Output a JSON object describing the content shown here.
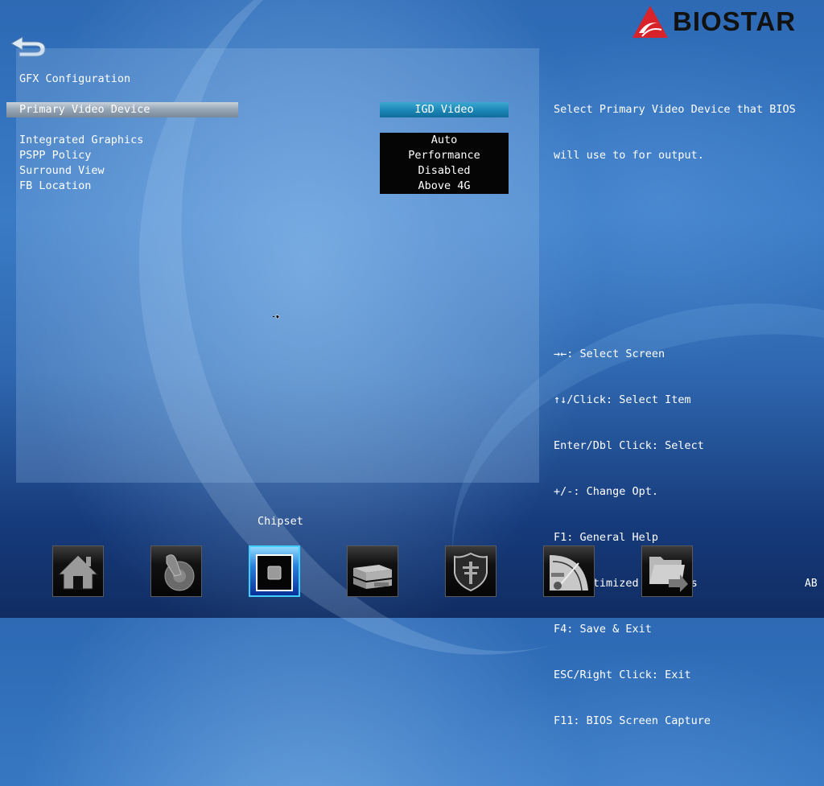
{
  "brand": {
    "name": "BIOSTAR"
  },
  "page": {
    "section_title": "GFX Configuration",
    "settings": [
      {
        "label": "Primary Video Device",
        "value": "IGD Video",
        "selected": true
      },
      {
        "label": "Integrated Graphics",
        "value": "Auto"
      },
      {
        "label": "PSPP Policy",
        "value": "Performance"
      },
      {
        "label": "Surround View",
        "value": "Disabled"
      },
      {
        "label": "FB Location",
        "value": "Above 4G"
      }
    ]
  },
  "help": {
    "line1": "Select Primary Video Device that BIOS",
    "line2": "will use to for output."
  },
  "keys": [
    "→←: Select Screen",
    "↑↓/Click: Select Item",
    "Enter/Dbl Click: Select",
    "+/-: Change Opt.",
    "F1: General Help",
    "F3: Optimized Defaults",
    "F4: Save & Exit",
    "ESC/Right Click: Exit",
    "F11: BIOS Screen Capture"
  ],
  "nav": {
    "active_label": "Chipset",
    "items": [
      {
        "name": "Main",
        "icon": "home-icon"
      },
      {
        "name": "Advanced",
        "icon": "joystick-icon"
      },
      {
        "name": "Chipset",
        "icon": "chip-icon",
        "active": true
      },
      {
        "name": "Boot",
        "icon": "drive-stack-icon"
      },
      {
        "name": "Security",
        "icon": "shield-icon"
      },
      {
        "name": "O.N.E",
        "icon": "speedometer-icon"
      },
      {
        "name": "Save & Exit",
        "icon": "folder-exit-icon"
      }
    ]
  },
  "language": "AB",
  "colors": {
    "accent": "#1d88b8",
    "active_border": "#3fd0ff",
    "logo_red": "#d8232a"
  }
}
